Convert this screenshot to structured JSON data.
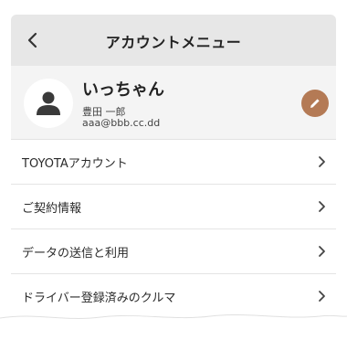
{
  "header": {
    "title": "アカウントメニュー"
  },
  "profile": {
    "nickname": "いっちゃん",
    "full_name": "豊田 一郎",
    "email": "aaa@bbb.cc.dd"
  },
  "menu": {
    "items": [
      {
        "label": "TOYOTAアカウント"
      },
      {
        "label": "ご契約情報"
      },
      {
        "label": "データの送信と利用"
      },
      {
        "label": "ドライバー登録済みのクルマ"
      }
    ]
  },
  "colors": {
    "header_bg": "#e7e7e7",
    "profile_bg": "#f4f4f4",
    "edit_button": "#b47a55",
    "avatar_icon": "#3a3a3a"
  },
  "icons": {
    "back": "back-arrow-icon",
    "avatar": "person-icon",
    "edit": "pencil-icon",
    "chevron": "chevron-right-icon"
  }
}
